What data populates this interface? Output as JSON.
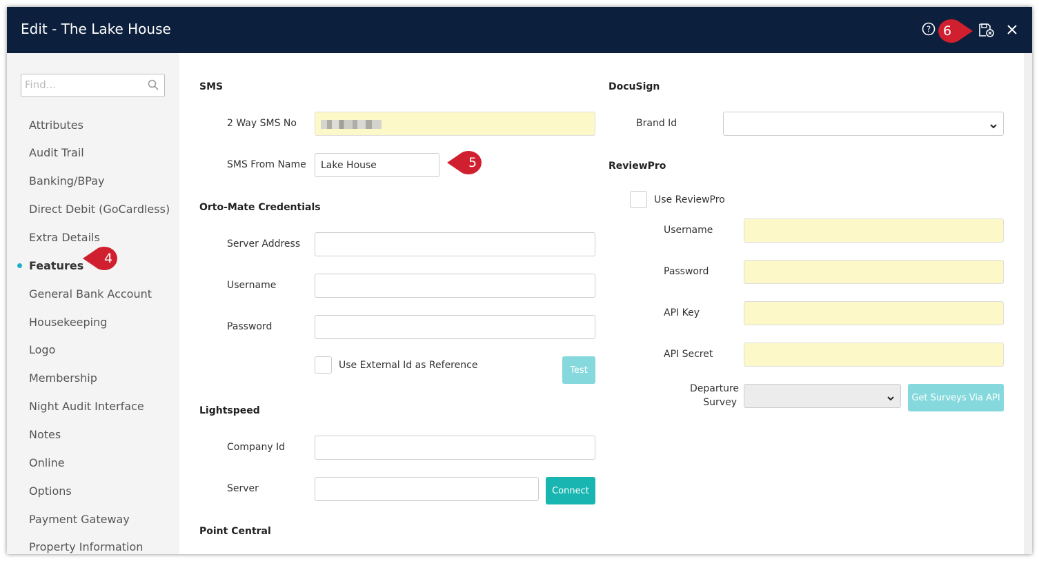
{
  "window": {
    "title": "Edit - The Lake House"
  },
  "titlebar": {
    "help_icon": "help-circle-icon",
    "save_icon": "save-close-icon",
    "close_icon": "close-icon"
  },
  "sidebar": {
    "search": {
      "placeholder": "Find..."
    },
    "items": [
      {
        "label": "Attributes"
      },
      {
        "label": "Audit Trail"
      },
      {
        "label": "Banking/BPay"
      },
      {
        "label": "Direct Debit (GoCardless)"
      },
      {
        "label": "Extra Details"
      },
      {
        "label": "Features",
        "active": true
      },
      {
        "label": "General Bank Account"
      },
      {
        "label": "Housekeeping"
      },
      {
        "label": "Logo"
      },
      {
        "label": "Membership"
      },
      {
        "label": "Night Audit Interface"
      },
      {
        "label": "Notes"
      },
      {
        "label": "Online"
      },
      {
        "label": "Options"
      },
      {
        "label": "Payment Gateway"
      },
      {
        "label": "Property Information"
      }
    ]
  },
  "sms": {
    "heading": "SMS",
    "two_way_label": "2 Way SMS No",
    "from_name_label": "SMS From Name",
    "from_name_value": "Lake House"
  },
  "orto": {
    "heading": "Orto-Mate Credentials",
    "server_label": "Server Address",
    "username_label": "Username",
    "password_label": "Password",
    "external_id_label": "Use External Id as Reference",
    "test_button": "Test"
  },
  "lightspeed": {
    "heading": "Lightspeed",
    "company_label": "Company Id",
    "server_label": "Server",
    "connect_button": "Connect"
  },
  "point_central": {
    "heading": "Point Central"
  },
  "docusign": {
    "heading": "DocuSign",
    "brand_label": "Brand Id"
  },
  "reviewpro": {
    "heading": "ReviewPro",
    "use_label": "Use ReviewPro",
    "username_label": "Username",
    "password_label": "Password",
    "api_key_label": "API Key",
    "api_secret_label": "API Secret",
    "departure_label_1": "Departure",
    "departure_label_2": "Survey",
    "get_surveys_button": "Get Surveys Via API"
  },
  "callouts": {
    "c4": "4",
    "c5": "5",
    "c6": "6"
  },
  "colors": {
    "titlebar": "#0c1f3d",
    "accent": "#19b6b1",
    "callout": "#d0202f",
    "required_field": "#fdf8c8"
  }
}
